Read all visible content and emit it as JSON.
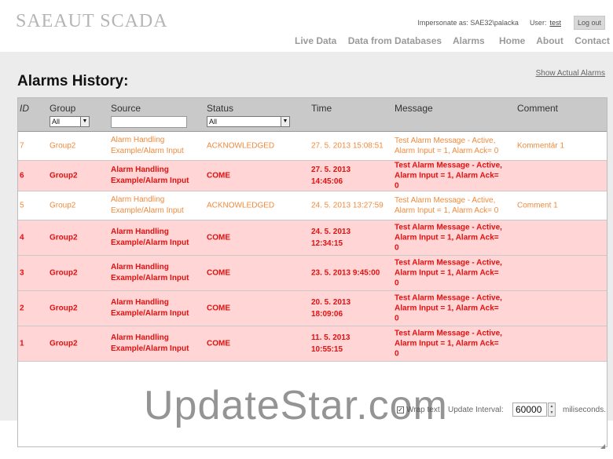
{
  "app": {
    "logo": "SAEAUT SCADA"
  },
  "userbar": {
    "impersonate": "Impersonate as: SAE32\\palacka",
    "user_label": "User:",
    "user_name": "test",
    "logout": "Log out"
  },
  "nav": {
    "left": [
      "Live Data",
      "Data from Databases",
      "Alarms"
    ],
    "right": [
      "Home",
      "About",
      "Contact"
    ]
  },
  "page": {
    "title": "Alarms History:",
    "show_actual": "Show Actual Alarms"
  },
  "table": {
    "headers": {
      "id": "ID",
      "group": "Group",
      "source": "Source",
      "status": "Status",
      "time": "Time",
      "message": "Message",
      "comment": "Comment"
    },
    "filters": {
      "group": "All",
      "status": "All",
      "source": ""
    },
    "rows": [
      {
        "id": "7",
        "group": "Group2",
        "source_1": "Alarm Handling",
        "source_2": "Example/Alarm Input",
        "status": "ACKNOWLEDGED",
        "time_1": "27. 5. 2013 15:08:51",
        "time_2": "",
        "msg_1": "Test Alarm Message - Active,",
        "msg_2": "Alarm Input = 1, Alarm Ack= 0",
        "msg_3": "",
        "comment": "Kommentár 1",
        "state": "ack"
      },
      {
        "id": "6",
        "group": "Group2",
        "source_1": "Alarm Handling",
        "source_2": "Example/Alarm Input",
        "status": "COME",
        "time_1": "27. 5. 2013",
        "time_2": "14:45:06",
        "msg_1": "Test Alarm Message - Active,",
        "msg_2": "Alarm Input = 1, Alarm Ack=",
        "msg_3": "0",
        "comment": "",
        "state": "come"
      },
      {
        "id": "5",
        "group": "Group2",
        "source_1": "Alarm Handling",
        "source_2": "Example/Alarm Input",
        "status": "ACKNOWLEDGED",
        "time_1": "24. 5. 2013 13:27:59",
        "time_2": "",
        "msg_1": "Test Alarm Message - Active,",
        "msg_2": "Alarm Input = 1, Alarm Ack= 0",
        "msg_3": "",
        "comment": "Comment 1",
        "state": "ack"
      },
      {
        "id": "4",
        "group": "Group2",
        "source_1": "Alarm Handling",
        "source_2": "Example/Alarm Input",
        "status": "COME",
        "time_1": "24. 5. 2013",
        "time_2": "12:34:15",
        "msg_1": "Test Alarm Message - Active,",
        "msg_2": "Alarm Input = 1, Alarm Ack=",
        "msg_3": "0",
        "comment": "",
        "state": "come"
      },
      {
        "id": "3",
        "group": "Group2",
        "source_1": "Alarm Handling",
        "source_2": "Example/Alarm Input",
        "status": "COME",
        "time_1": "23. 5. 2013 9:45:00",
        "time_2": "",
        "msg_1": "Test Alarm Message - Active,",
        "msg_2": "Alarm Input = 1, Alarm Ack=",
        "msg_3": "0",
        "comment": "",
        "state": "come"
      },
      {
        "id": "2",
        "group": "Group2",
        "source_1": "Alarm Handling",
        "source_2": "Example/Alarm Input",
        "status": "COME",
        "time_1": "20. 5. 2013",
        "time_2": "18:09:06",
        "msg_1": "Test Alarm Message - Active,",
        "msg_2": "Alarm Input = 1, Alarm Ack=",
        "msg_3": "0",
        "comment": "",
        "state": "come"
      },
      {
        "id": "1",
        "group": "Group2",
        "source_1": "Alarm Handling",
        "source_2": "Example/Alarm Input",
        "status": "COME",
        "time_1": "11. 5. 2013",
        "time_2": "10:55:15",
        "msg_1": "Test Alarm Message - Active,",
        "msg_2": "Alarm Input = 1, Alarm Ack=",
        "msg_3": "0",
        "comment": "",
        "state": "come"
      }
    ]
  },
  "footer": {
    "wrap_text": "Wrap text",
    "wrap_checked": true,
    "interval_label": "Update Interval:",
    "interval_value": "60000",
    "unit": "miliseconds."
  },
  "watermark": "UpdateStar.com",
  "colors": {
    "ack_text": "#f08a3c",
    "come_text": "#e11111",
    "come_bg": "#ffd5d5",
    "header_bg": "#c9c9c9",
    "content_bg": "#ececec"
  }
}
